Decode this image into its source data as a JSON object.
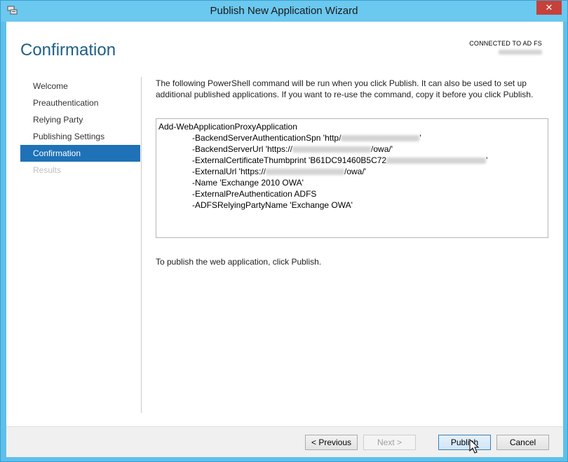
{
  "window": {
    "title": "Publish New Application Wizard",
    "close_label": "✕"
  },
  "header": {
    "page_title": "Confirmation",
    "connection_status": "CONNECTED TO AD FS"
  },
  "sidebar": {
    "items": [
      {
        "label": "Welcome",
        "state": "normal"
      },
      {
        "label": "Preauthentication",
        "state": "normal"
      },
      {
        "label": "Relying Party",
        "state": "normal"
      },
      {
        "label": "Publishing Settings",
        "state": "normal"
      },
      {
        "label": "Confirmation",
        "state": "active"
      },
      {
        "label": "Results",
        "state": "disabled"
      }
    ]
  },
  "main": {
    "description": "The following PowerShell command will be run when you click Publish. It can also be used to set up additional published applications. If you want to re-use the command, copy it before you click Publish.",
    "command": {
      "line0": "Add-WebApplicationProxyApplication",
      "spn_prefix": "-BackendServerAuthenticationSpn 'http/",
      "spn_suffix": "'",
      "backend_prefix": "-BackendServerUrl 'https://",
      "backend_suffix": "/owa/'",
      "thumb_prefix": "-ExternalCertificateThumbprint 'B61DC91460B5C72",
      "thumb_suffix": "'",
      "external_prefix": "-ExternalUrl 'https://",
      "external_suffix": "/owa/'",
      "name": "-Name 'Exchange 2010 OWA'",
      "preauth": "-ExternalPreAuthentication ADFS",
      "rp_name": "-ADFSRelyingPartyName 'Exchange OWA'"
    },
    "publish_note": "To publish the web application, click Publish."
  },
  "footer": {
    "previous": "< Previous",
    "next": "Next >",
    "publish": "Publish",
    "cancel": "Cancel"
  },
  "colors": {
    "frame": "#5ec0ea",
    "title_accent": "#1e5f86",
    "nav_active": "#1f72b7",
    "close_button": "#c7403a"
  }
}
